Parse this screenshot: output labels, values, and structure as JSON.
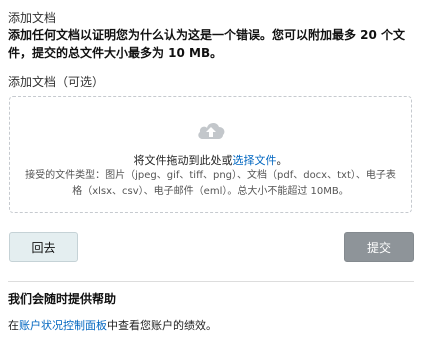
{
  "section_title": "添加文档",
  "instructions": "添加任何文档以证明您为什么认为这是一个错误。您可以附加最多 20 个文件，提交的总文件大小最多为 10 MB。",
  "upload": {
    "label": "添加文档（可选）",
    "drag_text": "将文件拖动到此处或",
    "choose_link": "选择文件",
    "drag_suffix": "。",
    "accepted_types": "接受的文件类型：图片（jpeg、gif、tiff、png）、文档（pdf、docx、txt）、电子表格（xlsx、csv）、电子邮件（eml）。总大小不能超过 10MB。",
    "icon": "cloud-upload-icon"
  },
  "buttons": {
    "back": "回去",
    "submit": "提交"
  },
  "help": {
    "title": "我们会随时提供帮助",
    "prefix": "在",
    "link": "账户状况控制面板",
    "suffix": "中查看您账户的绩效。"
  },
  "colors": {
    "link": "#0066c0",
    "submit_disabled": "#8e9499",
    "back_button": "#e4eef0",
    "icon": "#c3c7cb"
  }
}
